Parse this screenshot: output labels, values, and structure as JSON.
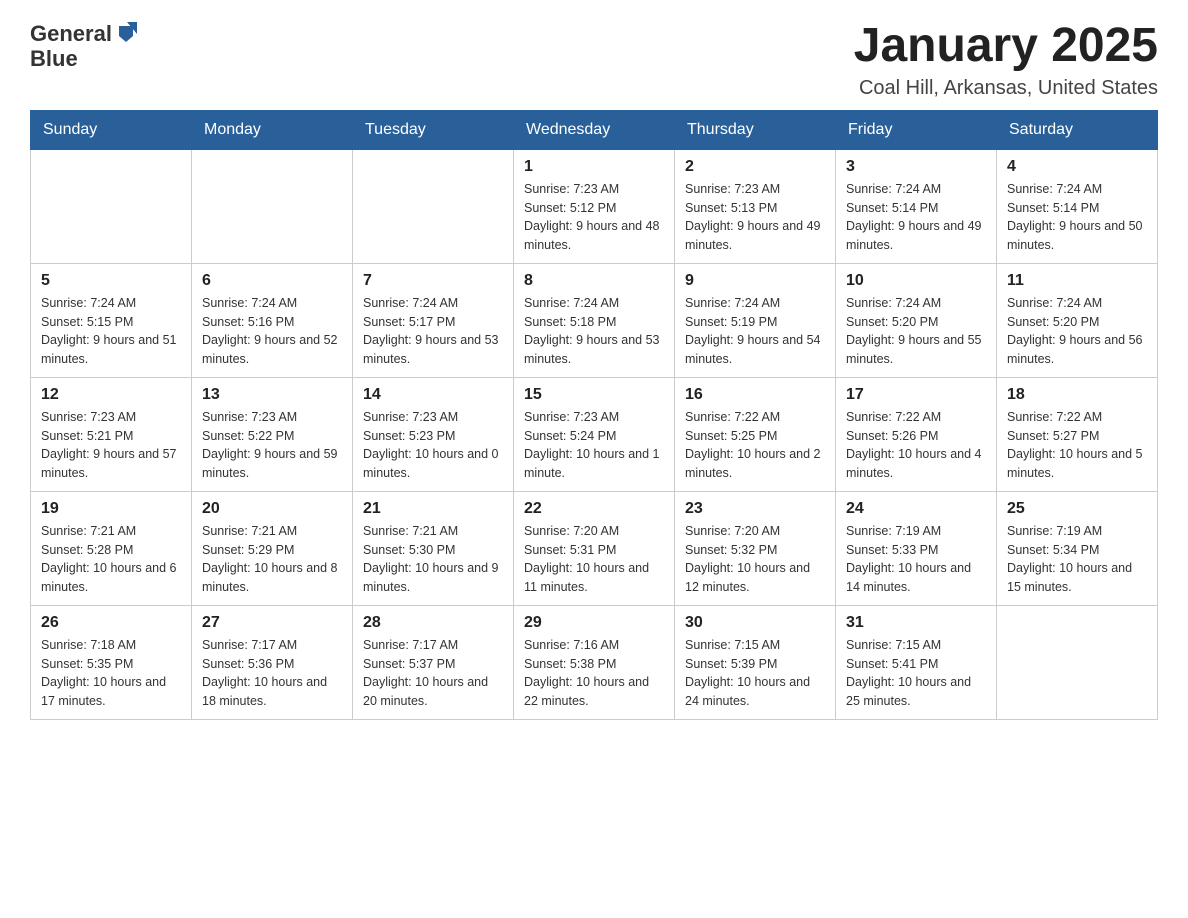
{
  "logo": {
    "name": "General",
    "name2": "Blue"
  },
  "title": "January 2025",
  "location": "Coal Hill, Arkansas, United States",
  "weekdays": [
    "Sunday",
    "Monday",
    "Tuesday",
    "Wednesday",
    "Thursday",
    "Friday",
    "Saturday"
  ],
  "weeks": [
    [
      {
        "day": "",
        "info": ""
      },
      {
        "day": "",
        "info": ""
      },
      {
        "day": "",
        "info": ""
      },
      {
        "day": "1",
        "info": "Sunrise: 7:23 AM\nSunset: 5:12 PM\nDaylight: 9 hours\nand 48 minutes."
      },
      {
        "day": "2",
        "info": "Sunrise: 7:23 AM\nSunset: 5:13 PM\nDaylight: 9 hours\nand 49 minutes."
      },
      {
        "day": "3",
        "info": "Sunrise: 7:24 AM\nSunset: 5:14 PM\nDaylight: 9 hours\nand 49 minutes."
      },
      {
        "day": "4",
        "info": "Sunrise: 7:24 AM\nSunset: 5:14 PM\nDaylight: 9 hours\nand 50 minutes."
      }
    ],
    [
      {
        "day": "5",
        "info": "Sunrise: 7:24 AM\nSunset: 5:15 PM\nDaylight: 9 hours\nand 51 minutes."
      },
      {
        "day": "6",
        "info": "Sunrise: 7:24 AM\nSunset: 5:16 PM\nDaylight: 9 hours\nand 52 minutes."
      },
      {
        "day": "7",
        "info": "Sunrise: 7:24 AM\nSunset: 5:17 PM\nDaylight: 9 hours\nand 53 minutes."
      },
      {
        "day": "8",
        "info": "Sunrise: 7:24 AM\nSunset: 5:18 PM\nDaylight: 9 hours\nand 53 minutes."
      },
      {
        "day": "9",
        "info": "Sunrise: 7:24 AM\nSunset: 5:19 PM\nDaylight: 9 hours\nand 54 minutes."
      },
      {
        "day": "10",
        "info": "Sunrise: 7:24 AM\nSunset: 5:20 PM\nDaylight: 9 hours\nand 55 minutes."
      },
      {
        "day": "11",
        "info": "Sunrise: 7:24 AM\nSunset: 5:20 PM\nDaylight: 9 hours\nand 56 minutes."
      }
    ],
    [
      {
        "day": "12",
        "info": "Sunrise: 7:23 AM\nSunset: 5:21 PM\nDaylight: 9 hours\nand 57 minutes."
      },
      {
        "day": "13",
        "info": "Sunrise: 7:23 AM\nSunset: 5:22 PM\nDaylight: 9 hours\nand 59 minutes."
      },
      {
        "day": "14",
        "info": "Sunrise: 7:23 AM\nSunset: 5:23 PM\nDaylight: 10 hours\nand 0 minutes."
      },
      {
        "day": "15",
        "info": "Sunrise: 7:23 AM\nSunset: 5:24 PM\nDaylight: 10 hours\nand 1 minute."
      },
      {
        "day": "16",
        "info": "Sunrise: 7:22 AM\nSunset: 5:25 PM\nDaylight: 10 hours\nand 2 minutes."
      },
      {
        "day": "17",
        "info": "Sunrise: 7:22 AM\nSunset: 5:26 PM\nDaylight: 10 hours\nand 4 minutes."
      },
      {
        "day": "18",
        "info": "Sunrise: 7:22 AM\nSunset: 5:27 PM\nDaylight: 10 hours\nand 5 minutes."
      }
    ],
    [
      {
        "day": "19",
        "info": "Sunrise: 7:21 AM\nSunset: 5:28 PM\nDaylight: 10 hours\nand 6 minutes."
      },
      {
        "day": "20",
        "info": "Sunrise: 7:21 AM\nSunset: 5:29 PM\nDaylight: 10 hours\nand 8 minutes."
      },
      {
        "day": "21",
        "info": "Sunrise: 7:21 AM\nSunset: 5:30 PM\nDaylight: 10 hours\nand 9 minutes."
      },
      {
        "day": "22",
        "info": "Sunrise: 7:20 AM\nSunset: 5:31 PM\nDaylight: 10 hours\nand 11 minutes."
      },
      {
        "day": "23",
        "info": "Sunrise: 7:20 AM\nSunset: 5:32 PM\nDaylight: 10 hours\nand 12 minutes."
      },
      {
        "day": "24",
        "info": "Sunrise: 7:19 AM\nSunset: 5:33 PM\nDaylight: 10 hours\nand 14 minutes."
      },
      {
        "day": "25",
        "info": "Sunrise: 7:19 AM\nSunset: 5:34 PM\nDaylight: 10 hours\nand 15 minutes."
      }
    ],
    [
      {
        "day": "26",
        "info": "Sunrise: 7:18 AM\nSunset: 5:35 PM\nDaylight: 10 hours\nand 17 minutes."
      },
      {
        "day": "27",
        "info": "Sunrise: 7:17 AM\nSunset: 5:36 PM\nDaylight: 10 hours\nand 18 minutes."
      },
      {
        "day": "28",
        "info": "Sunrise: 7:17 AM\nSunset: 5:37 PM\nDaylight: 10 hours\nand 20 minutes."
      },
      {
        "day": "29",
        "info": "Sunrise: 7:16 AM\nSunset: 5:38 PM\nDaylight: 10 hours\nand 22 minutes."
      },
      {
        "day": "30",
        "info": "Sunrise: 7:15 AM\nSunset: 5:39 PM\nDaylight: 10 hours\nand 24 minutes."
      },
      {
        "day": "31",
        "info": "Sunrise: 7:15 AM\nSunset: 5:41 PM\nDaylight: 10 hours\nand 25 minutes."
      },
      {
        "day": "",
        "info": ""
      }
    ]
  ]
}
